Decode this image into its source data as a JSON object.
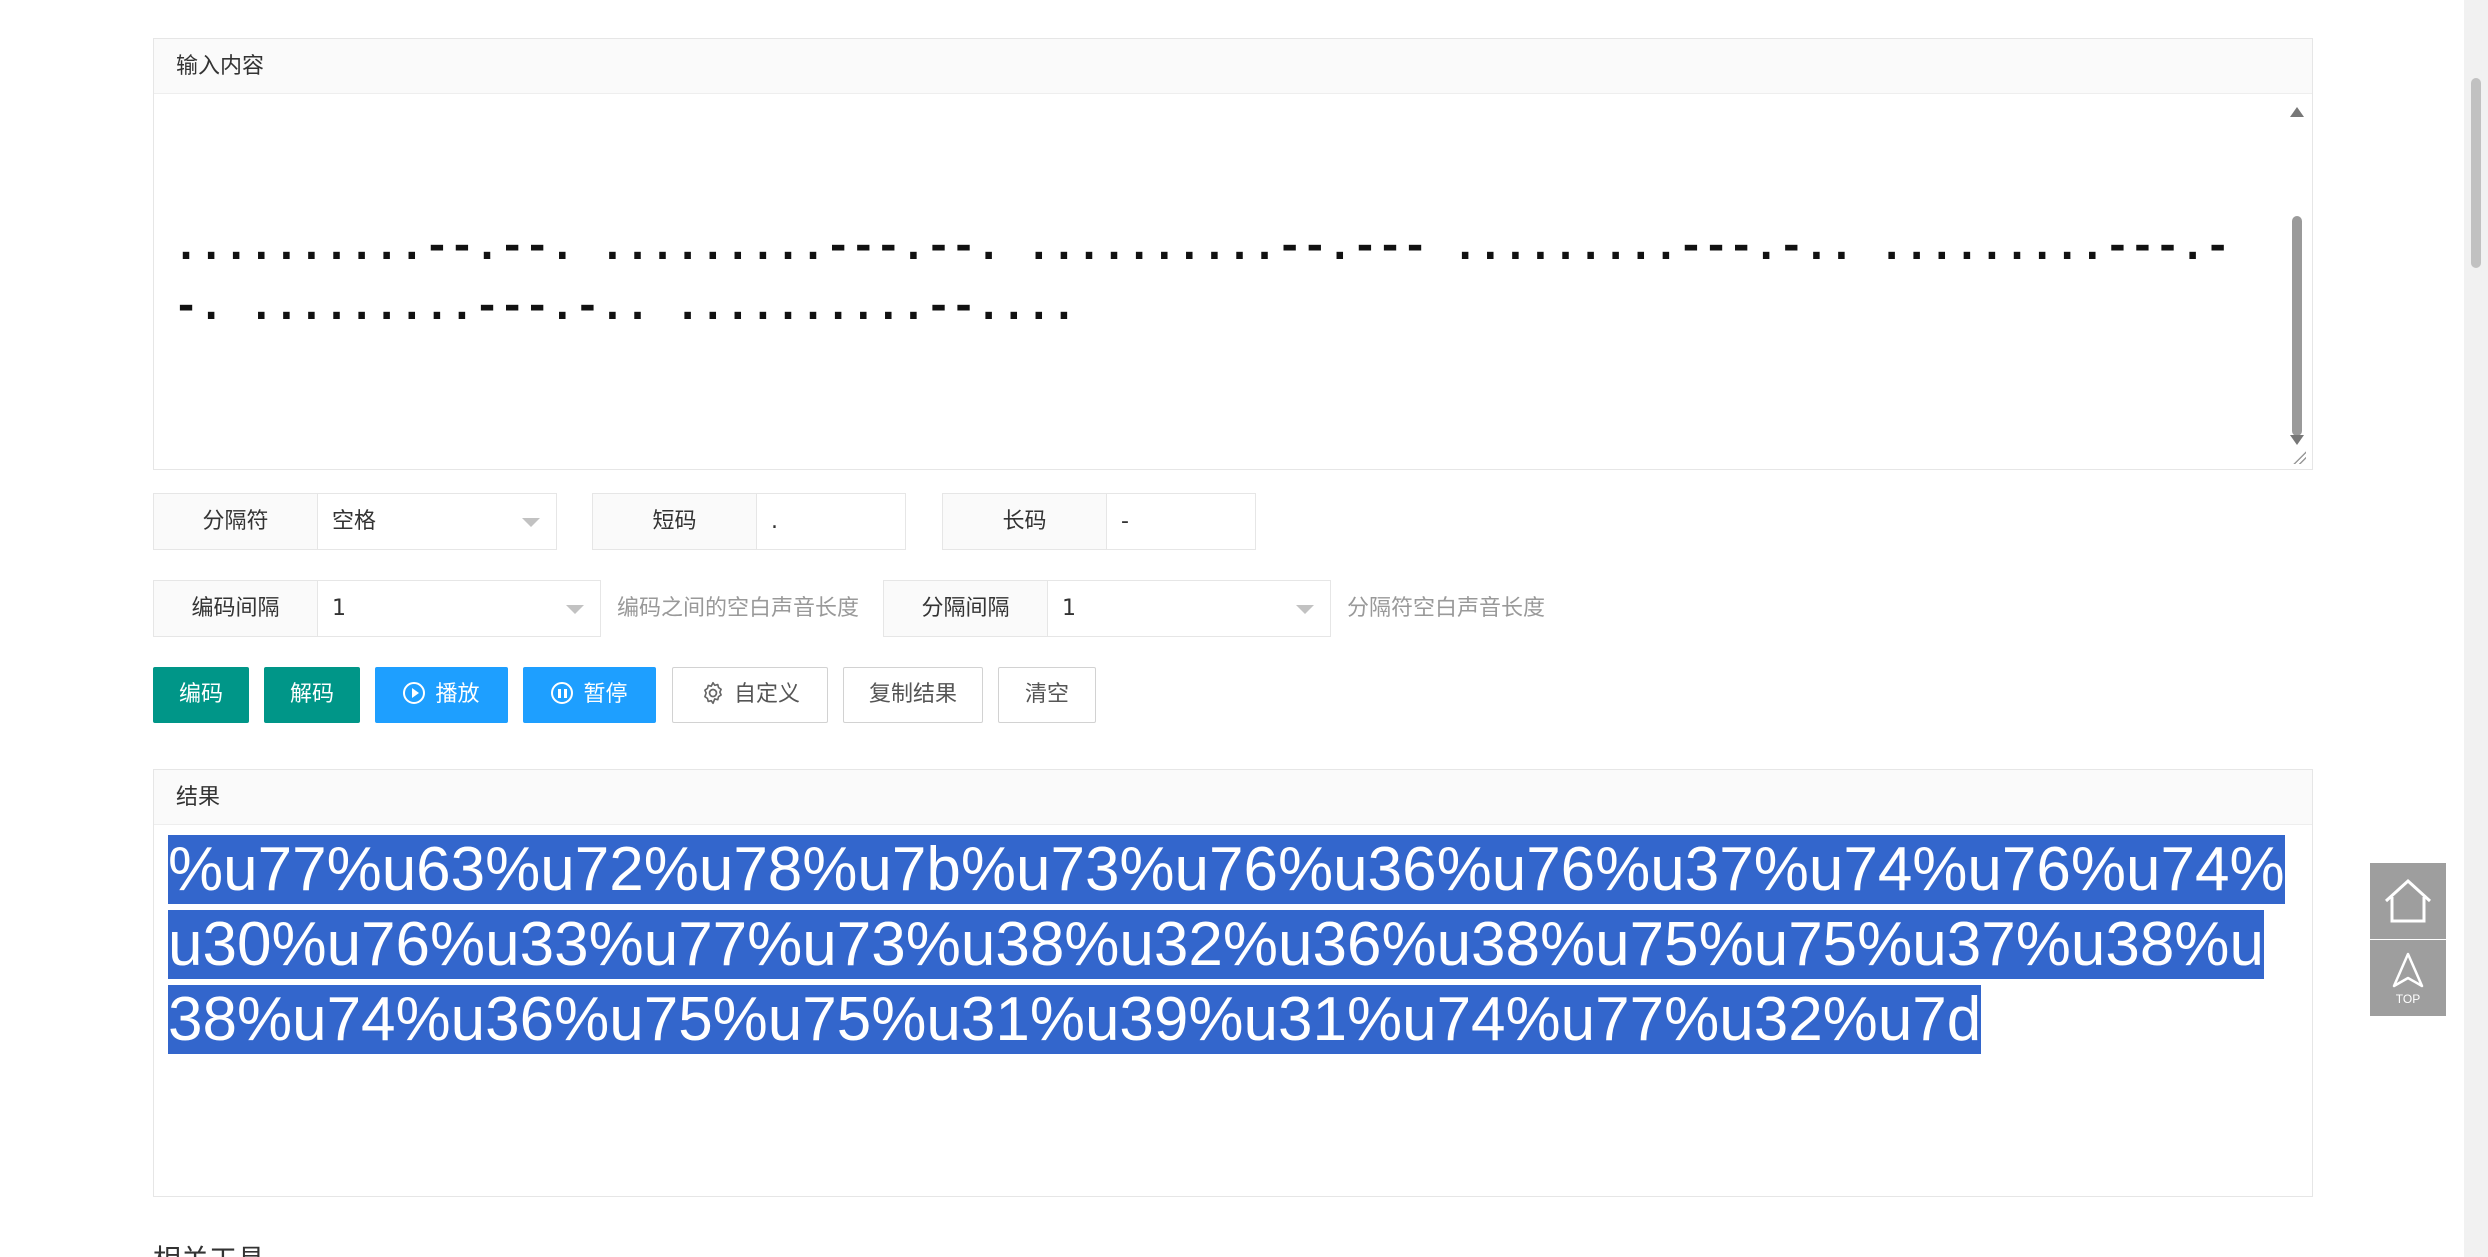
{
  "input": {
    "title": "输入内容",
    "morse_lines": [
      "..........--.--. .........---.--. ..........--.--- .........---.-.. .........---.--. .........---.-.. ..........--....",
      ".........---.--. ..........--..-- .........---.--- .........---..-- ..........---... ..........--..-. ..........--.--.",
      "..........---... .........---.-.- .........---.-.- ..........--.--- ..........---... ..........---... .........---.-..",
      "..........--.--. .........---.-.- .........---.-.- ..........--...- ..........---..- ..........--...- .........---.-..",
      ".........---.--- ..........--..-. .........-----.-"
    ]
  },
  "options": {
    "separator_label": "分隔符",
    "separator_value": "空格",
    "short_label": "短码",
    "short_value": ".",
    "long_label": "长码",
    "long_value": "-",
    "code_gap_label": "编码间隔",
    "code_gap_value": "1",
    "code_gap_hint": "编码之间的空白声音长度",
    "sep_gap_label": "分隔间隔",
    "sep_gap_value": "1",
    "sep_gap_hint": "分隔符空白声音长度"
  },
  "buttons": {
    "encode": "编码",
    "decode": "解码",
    "play": "播放",
    "pause": "暂停",
    "custom": "自定义",
    "copy": "复制结果",
    "clear": "清空"
  },
  "result": {
    "title": "结果",
    "text": "%u77%u63%u72%u78%u7b%u73%u76%u36%u76%u37%u74%u76%u74%u30%u76%u33%u77%u73%u38%u32%u36%u38%u75%u75%u37%u38%u38%u74%u36%u75%u75%u31%u39%u31%u74%u77%u32%u7d"
  },
  "side": {
    "top_label": "TOP"
  },
  "footer": {
    "partial_heading": "相关工具"
  },
  "colors": {
    "primary_green": "#009688",
    "primary_blue": "#1e9fff",
    "selection": "#3366cc"
  }
}
